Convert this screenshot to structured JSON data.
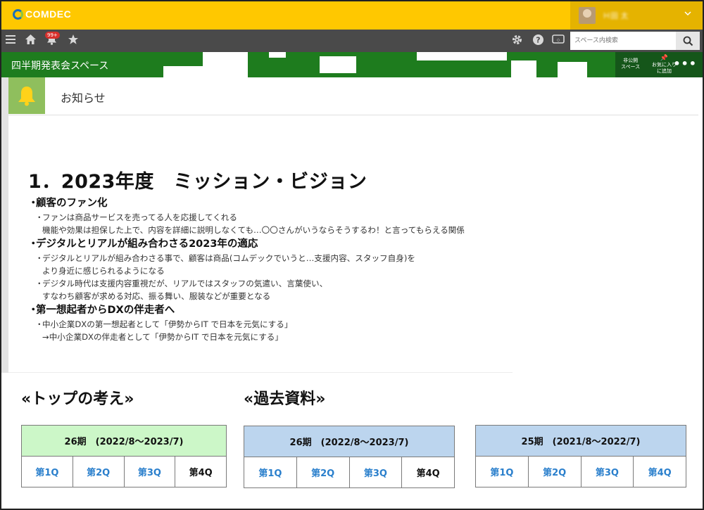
{
  "header": {
    "brand": "COMDEC",
    "user_name": "Ｈ田 太",
    "notification_count": "99+",
    "search_placeholder": "スペース内検索"
  },
  "space": {
    "title": "四半期発表会スペース",
    "actions": [
      {
        "line1": "非公開",
        "line2": "スペース"
      },
      {
        "line1": "お気に入り",
        "line2": "に追加"
      }
    ]
  },
  "notice": {
    "title": "お知らせ",
    "heading": "1．2023年度　ミッション・ビジョン",
    "sections": [
      {
        "title": "顧客のファン化",
        "items": [
          "ファンは商品サービスを売ってる人を応援してくれる\n機能や効果は担保した上で、内容を詳細に説明しなくても…〇〇さんがいうならそうするわ！と言ってもらえる関係"
        ]
      },
      {
        "title": "デジタルとリアルが組み合わさる2023年の適応",
        "items": [
          "デジタルとリアルが組み合わさる事で、顧客は商品(コムデックでいうと…支援内容、スタッフ自身)を\nより身近に感じられるようになる",
          "デジタル時代は支援内容重視だが、リアルではスタッフの気遣い、言葉使い、\nすなわち顧客が求める対応、振る舞い、服装などが重要となる"
        ]
      },
      {
        "title": "第一想起者からDXの伴走者へ",
        "items": [
          "中小企業DXの第一想起者として「伊勢からIT で日本を元気にする」\n→中小企業DXの伴走者として「伊勢からIT で日本を元気にする」"
        ]
      }
    ]
  },
  "top_thoughts": {
    "heading": "«トップの考え»",
    "period": "26期　(2022/8～2023/7)",
    "quarters": [
      "第1Q",
      "第2Q",
      "第3Q",
      "第4Q"
    ]
  },
  "past_materials": {
    "heading": "«過去資料»",
    "tables": [
      {
        "period": "26期　(2022/8～2023/7)",
        "quarters": [
          "第1Q",
          "第2Q",
          "第3Q",
          "第4Q"
        ]
      },
      {
        "period": "25期　(2021/8～2022/7)",
        "quarters": [
          "第1Q",
          "第2Q",
          "第3Q",
          "第4Q"
        ]
      }
    ]
  },
  "colors": {
    "brand_yellow": "#ffc800",
    "toolbar": "#4a4a4a",
    "space_green": "#1e7c1e",
    "bell_green": "#8fbf5d",
    "table_green": "#ccf7c8",
    "table_blue": "#bcd5ee",
    "link_blue": "#2a7fcc"
  }
}
